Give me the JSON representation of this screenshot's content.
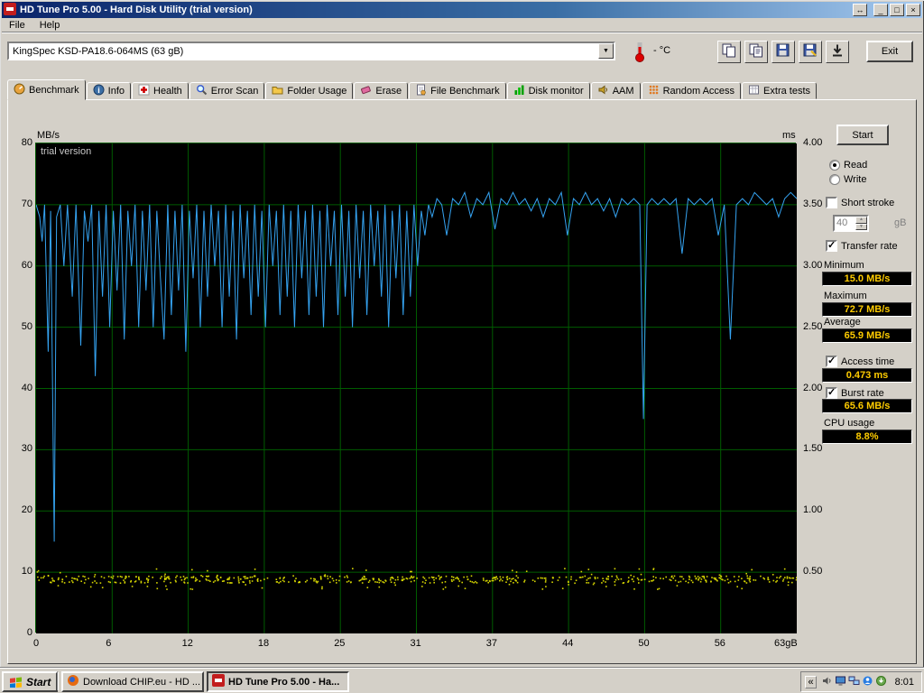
{
  "window": {
    "title": "HD Tune Pro 5.00 - Hard Disk Utility (trial version)",
    "controls": [
      {
        "name": "restore-down-button",
        "glyph": "↔"
      },
      {
        "name": "minimize-button",
        "glyph": "_"
      },
      {
        "name": "maximize-button",
        "glyph": "□"
      },
      {
        "name": "close-button",
        "glyph": "×"
      }
    ]
  },
  "menu": {
    "items": [
      "File",
      "Help"
    ]
  },
  "toolbar": {
    "drive_selector": "KingSpec KSD-PA18.6-064MS (63 gB)",
    "temperature": "- °C",
    "exit_label": "Exit",
    "buttons": [
      {
        "name": "copy-image-button",
        "icon": "copy-image"
      },
      {
        "name": "copy-text-button",
        "icon": "copy-text"
      },
      {
        "name": "save-image-button",
        "icon": "save-image"
      },
      {
        "name": "save-text-button",
        "icon": "save-text"
      },
      {
        "name": "download-button",
        "icon": "download"
      }
    ]
  },
  "tabs": [
    {
      "label": "Benchmark",
      "icon": "benchmark"
    },
    {
      "label": "Info",
      "icon": "info"
    },
    {
      "label": "Health",
      "icon": "health"
    },
    {
      "label": "Error Scan",
      "icon": "error-scan"
    },
    {
      "label": "Folder Usage",
      "icon": "folder-usage"
    },
    {
      "label": "Erase",
      "icon": "erase"
    },
    {
      "label": "File Benchmark",
      "icon": "file-benchmark"
    },
    {
      "label": "Disk monitor",
      "icon": "disk-monitor"
    },
    {
      "label": "AAM",
      "icon": "aam"
    },
    {
      "label": "Random Access",
      "icon": "random-access"
    },
    {
      "label": "Extra tests",
      "icon": "extra-tests"
    }
  ],
  "active_tab": "Benchmark",
  "controls": {
    "start_button": "Start",
    "read_label": "Read",
    "write_label": "Write",
    "selected_mode": "Read",
    "short_stroke_label": "Short stroke",
    "short_stroke_checked": false,
    "short_stroke_value": "40",
    "short_stroke_unit": "gB",
    "transfer_rate_label": "Transfer rate",
    "transfer_rate_checked": true,
    "minimum_label": "Minimum",
    "minimum_value": "15.0 MB/s",
    "maximum_label": "Maximum",
    "maximum_value": "72.7 MB/s",
    "average_label": "Average",
    "average_value": "65.9 MB/s",
    "access_time_label": "Access time",
    "access_time_checked": true,
    "access_time_value": "0.473 ms",
    "burst_rate_label": "Burst rate",
    "burst_rate_checked": true,
    "burst_rate_value": "65.6 MB/s",
    "cpu_usage_label": "CPU usage",
    "cpu_usage_value": "8.8%"
  },
  "taskbar": {
    "start_label": "Start",
    "tasks": [
      {
        "label": "Download CHIP.eu - HD ...",
        "icon": "browser",
        "active": false
      },
      {
        "label": "HD Tune Pro 5.00 - Ha...",
        "icon": "hdtune",
        "active": true
      }
    ],
    "collapse_chevron": "«",
    "tray_icons": [
      "volume-icon",
      "display-icon",
      "network-icon",
      "messenger-icon",
      "updates-icon"
    ],
    "clock": "8:01"
  },
  "chart_data": {
    "type": "line",
    "overlay_text": "trial version",
    "y_left": {
      "label": "MB/s",
      "min": 0,
      "max": 80,
      "ticks": [
        80,
        70,
        60,
        50,
        40,
        30,
        20,
        10,
        0
      ]
    },
    "y_right": {
      "label": "ms",
      "min": 0,
      "max": 4.0,
      "ticks": [
        "4.00",
        "3.50",
        "3.00",
        "2.50",
        "2.00",
        "1.50",
        "1.00",
        "0.50"
      ]
    },
    "x": {
      "label": "gB",
      "min": 0,
      "max": 63,
      "tick_labels": [
        "0",
        "6",
        "12",
        "18",
        "25",
        "31",
        "37",
        "44",
        "50",
        "56",
        "63gB"
      ]
    },
    "colors": {
      "bg": "#000000",
      "grid": "#005c00",
      "transfer": "#35a3f1",
      "access": "#d4d400"
    },
    "series": [
      {
        "name": "Transfer rate",
        "unit": "MB/s",
        "color": "#35a3f1",
        "points": [
          [
            0,
            70
          ],
          [
            0.3,
            68
          ],
          [
            0.5,
            64
          ],
          [
            0.7,
            70
          ],
          [
            1,
            46
          ],
          [
            1.2,
            69
          ],
          [
            1.5,
            15
          ],
          [
            1.7,
            68
          ],
          [
            2,
            70
          ],
          [
            2.3,
            60
          ],
          [
            2.6,
            70
          ],
          [
            3,
            55
          ],
          [
            3.3,
            70
          ],
          [
            3.7,
            47
          ],
          [
            4,
            69
          ],
          [
            4.3,
            64
          ],
          [
            4.6,
            70
          ],
          [
            4.9,
            42
          ],
          [
            5.2,
            69
          ],
          [
            5.5,
            55
          ],
          [
            5.8,
            70
          ],
          [
            6.1,
            50
          ],
          [
            6.4,
            69
          ],
          [
            6.7,
            56
          ],
          [
            7,
            70
          ],
          [
            7.3,
            48
          ],
          [
            7.6,
            69
          ],
          [
            7.9,
            60
          ],
          [
            8.2,
            70
          ],
          [
            8.5,
            50
          ],
          [
            8.8,
            69
          ],
          [
            9.1,
            56
          ],
          [
            9.4,
            70
          ],
          [
            9.7,
            50
          ],
          [
            10,
            69
          ],
          [
            10.3,
            58
          ],
          [
            10.6,
            48
          ],
          [
            10.9,
            70
          ],
          [
            11.2,
            52
          ],
          [
            11.5,
            69
          ],
          [
            11.8,
            56
          ],
          [
            12.1,
            70
          ],
          [
            12.4,
            46
          ],
          [
            12.7,
            69
          ],
          [
            13,
            58
          ],
          [
            13.3,
            70
          ],
          [
            13.6,
            50
          ],
          [
            13.9,
            69
          ],
          [
            14.2,
            55
          ],
          [
            14.5,
            70
          ],
          [
            14.8,
            60
          ],
          [
            15.1,
            69
          ],
          [
            15.4,
            50
          ],
          [
            15.7,
            70
          ],
          [
            16,
            55
          ],
          [
            16.3,
            69
          ],
          [
            16.6,
            48
          ],
          [
            16.9,
            70
          ],
          [
            17.2,
            58
          ],
          [
            17.5,
            69
          ],
          [
            17.8,
            52
          ],
          [
            18.1,
            70
          ],
          [
            18.4,
            55
          ],
          [
            18.7,
            69
          ],
          [
            19,
            50
          ],
          [
            19.3,
            70
          ],
          [
            19.6,
            60
          ],
          [
            19.9,
            69
          ],
          [
            20.2,
            52
          ],
          [
            20.5,
            70
          ],
          [
            20.8,
            55
          ],
          [
            21.1,
            69
          ],
          [
            21.4,
            50
          ],
          [
            21.7,
            70
          ],
          [
            22,
            58
          ],
          [
            22.3,
            69
          ],
          [
            22.6,
            52
          ],
          [
            22.9,
            70
          ],
          [
            23.2,
            55
          ],
          [
            23.5,
            69
          ],
          [
            23.8,
            50
          ],
          [
            24.1,
            70
          ],
          [
            24.4,
            60
          ],
          [
            24.7,
            69
          ],
          [
            25,
            52
          ],
          [
            25.3,
            70
          ],
          [
            25.6,
            55
          ],
          [
            25.9,
            69
          ],
          [
            26.2,
            50
          ],
          [
            26.5,
            70
          ],
          [
            26.8,
            58
          ],
          [
            27.1,
            69
          ],
          [
            27.4,
            52
          ],
          [
            27.7,
            70
          ],
          [
            28,
            60
          ],
          [
            28.3,
            69
          ],
          [
            28.6,
            55
          ],
          [
            28.9,
            70
          ],
          [
            29.2,
            50
          ],
          [
            29.5,
            69
          ],
          [
            29.8,
            58
          ],
          [
            30.1,
            70
          ],
          [
            30.4,
            52
          ],
          [
            30.7,
            69
          ],
          [
            31,
            55
          ],
          [
            31.3,
            70
          ],
          [
            31.6,
            60
          ],
          [
            31.9,
            69
          ],
          [
            32.2,
            65
          ],
          [
            32.5,
            70
          ],
          [
            32.8,
            68
          ],
          [
            33.2,
            71
          ],
          [
            33.6,
            70
          ],
          [
            34,
            65
          ],
          [
            34.5,
            71
          ],
          [
            35,
            70
          ],
          [
            35.5,
            72
          ],
          [
            36,
            68
          ],
          [
            36.5,
            71
          ],
          [
            37,
            70
          ],
          [
            37.5,
            72
          ],
          [
            38,
            66
          ],
          [
            38.5,
            71
          ],
          [
            39,
            70
          ],
          [
            39.5,
            72
          ],
          [
            40,
            70
          ],
          [
            40.5,
            71
          ],
          [
            41,
            69
          ],
          [
            41.5,
            71
          ],
          [
            42,
            68
          ],
          [
            42.5,
            71
          ],
          [
            43,
            70
          ],
          [
            43.5,
            72
          ],
          [
            44,
            65
          ],
          [
            44.5,
            71
          ],
          [
            45,
            70
          ],
          [
            45.5,
            72
          ],
          [
            46,
            70
          ],
          [
            46.5,
            71
          ],
          [
            47,
            69
          ],
          [
            47.5,
            71
          ],
          [
            48,
            68
          ],
          [
            48.5,
            71
          ],
          [
            49,
            70
          ],
          [
            49.5,
            71
          ],
          [
            50,
            70
          ],
          [
            50.3,
            35
          ],
          [
            50.6,
            70
          ],
          [
            51,
            71
          ],
          [
            51.5,
            70
          ],
          [
            52,
            71
          ],
          [
            52.5,
            70
          ],
          [
            53,
            71
          ],
          [
            53.5,
            62
          ],
          [
            54,
            71
          ],
          [
            54.5,
            70
          ],
          [
            55,
            71
          ],
          [
            55.5,
            70
          ],
          [
            56,
            71
          ],
          [
            56.5,
            65
          ],
          [
            57,
            70
          ],
          [
            57.5,
            48
          ],
          [
            58,
            70
          ],
          [
            58.5,
            71
          ],
          [
            59,
            70
          ],
          [
            59.5,
            72
          ],
          [
            60,
            71
          ],
          [
            60.5,
            70
          ],
          [
            61,
            71
          ],
          [
            61.5,
            68
          ],
          [
            62,
            71
          ],
          [
            62.5,
            72
          ],
          [
            63,
            71
          ]
        ]
      },
      {
        "name": "Access time",
        "unit": "ms",
        "color": "#d4d400",
        "band": {
          "min_ms": 0.36,
          "max_ms": 0.52,
          "typical_ms": 0.44
        },
        "sample_count": 600
      }
    ],
    "results": {
      "minimum": "15.0 MB/s",
      "maximum": "72.7 MB/s",
      "average": "65.9 MB/s",
      "access_time": "0.473 ms",
      "burst_rate": "65.6 MB/s",
      "cpu_usage": "8.8%"
    }
  }
}
